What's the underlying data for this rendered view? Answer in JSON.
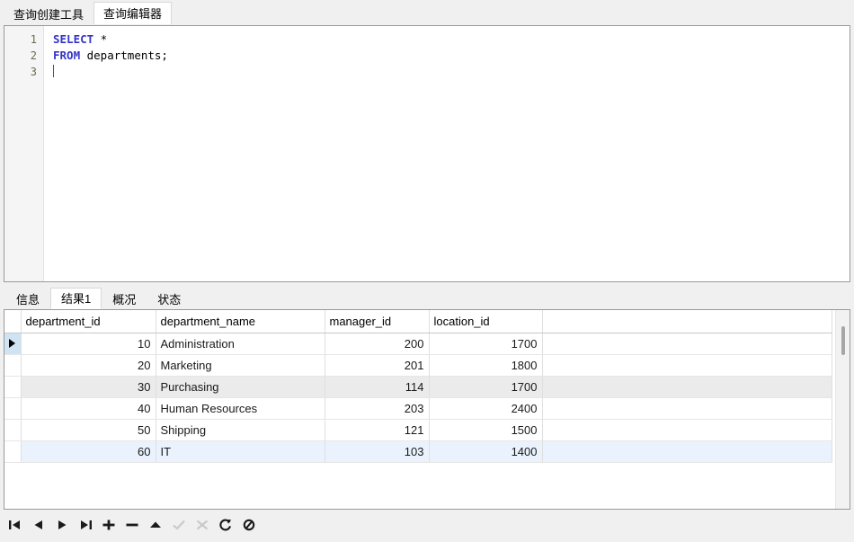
{
  "editor_tabs": [
    {
      "label": "查询创建工具",
      "active": false
    },
    {
      "label": "查询编辑器",
      "active": true
    }
  ],
  "sql_editor": {
    "lines": [
      {
        "number": "1",
        "keyword": "SELECT",
        "rest": " *"
      },
      {
        "number": "2",
        "keyword": "FROM",
        "rest": " departments;"
      },
      {
        "number": "3",
        "keyword": "",
        "rest": ""
      }
    ]
  },
  "result_tabs": [
    {
      "label": "信息",
      "active": false
    },
    {
      "label": "结果1",
      "active": true
    },
    {
      "label": "概况",
      "active": false
    },
    {
      "label": "状态",
      "active": false
    }
  ],
  "grid": {
    "columns": [
      "department_id",
      "department_name",
      "manager_id",
      "location_id"
    ],
    "selected_column": "department_id",
    "rows": [
      {
        "department_id": "10",
        "department_name": "Administration",
        "manager_id": "200",
        "location_id": "1700",
        "style": "current"
      },
      {
        "department_id": "20",
        "department_name": "Marketing",
        "manager_id": "201",
        "location_id": "1800",
        "style": "normal"
      },
      {
        "department_id": "30",
        "department_name": "Purchasing",
        "manager_id": "114",
        "location_id": "1700",
        "style": "alt"
      },
      {
        "department_id": "40",
        "department_name": "Human Resources",
        "manager_id": "203",
        "location_id": "2400",
        "style": "normal"
      },
      {
        "department_id": "50",
        "department_name": "Shipping",
        "manager_id": "121",
        "location_id": "1500",
        "style": "normal"
      },
      {
        "department_id": "60",
        "department_name": "IT",
        "manager_id": "103",
        "location_id": "1400",
        "style": "hl"
      }
    ]
  },
  "navigator": {
    "buttons": [
      {
        "name": "first-record-icon",
        "enabled": true
      },
      {
        "name": "previous-record-icon",
        "enabled": true
      },
      {
        "name": "next-record-icon",
        "enabled": true
      },
      {
        "name": "last-record-icon",
        "enabled": true
      },
      {
        "name": "add-record-icon",
        "enabled": true
      },
      {
        "name": "delete-record-icon",
        "enabled": true
      },
      {
        "name": "edit-record-icon",
        "enabled": true
      },
      {
        "name": "apply-changes-icon",
        "enabled": false
      },
      {
        "name": "discard-changes-icon",
        "enabled": false
      },
      {
        "name": "refresh-icon",
        "enabled": true
      },
      {
        "name": "stop-icon",
        "enabled": true
      }
    ]
  },
  "colors": {
    "keyword": "#3333cc",
    "selected_header": "#cfe3f5",
    "alt_row": "#ebebeb",
    "highlight_row": "#eaf3fd"
  }
}
